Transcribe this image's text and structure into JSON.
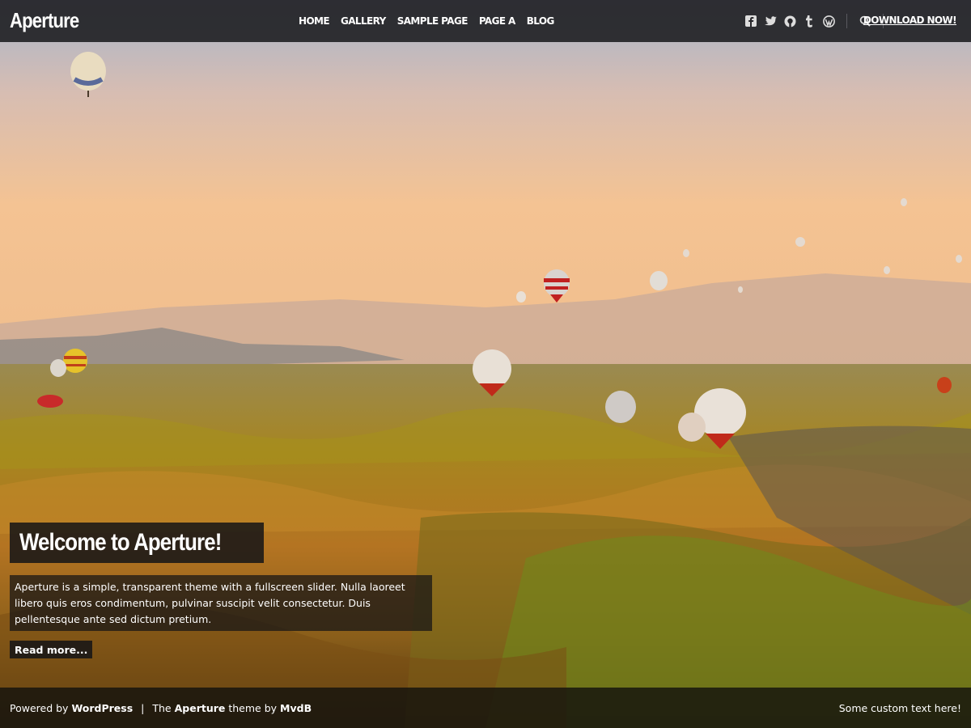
{
  "header": {
    "logo": "Aperture",
    "nav": [
      "HOME",
      "GALLERY",
      "SAMPLE PAGE",
      "PAGE A",
      "BLOG"
    ],
    "social_icons": [
      "facebook-icon",
      "twitter-icon",
      "github-icon",
      "tumblr-icon",
      "wordpress-icon"
    ],
    "search_icon": "search-icon",
    "download_label": "DOWNLOAD NOW!"
  },
  "hero": {
    "title": "Welcome to Aperture!",
    "text": "Aperture is a simple, transparent theme with a fullscreen slider. Nulla laoreet libero quis eros condimentum, pulvinar suscipit velit consectetur. Duis pellentesque ante sed dictum pretium.",
    "read_more": "Read more..."
  },
  "footer": {
    "powered_prefix": "Powered by",
    "powered_link": "WordPress",
    "separator": "|",
    "theme_prefix": "The",
    "theme_name": "Aperture",
    "theme_mid": "theme by",
    "theme_author": "MvdB",
    "custom_text": "Some custom text here!"
  },
  "colors": {
    "header_bg": "#26262a",
    "text": "#ffffff"
  }
}
